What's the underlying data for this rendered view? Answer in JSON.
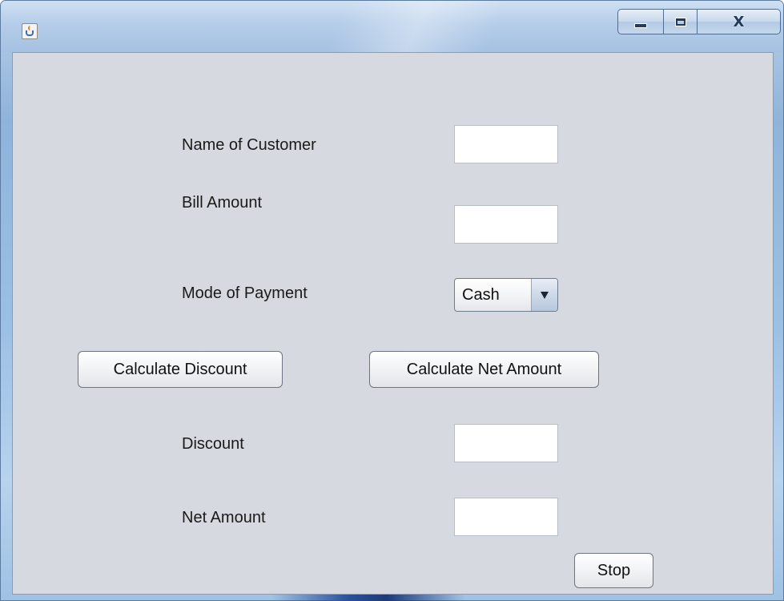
{
  "window": {
    "title": "",
    "icon": "java-cup-icon",
    "controls": {
      "minimize": "minimize-icon",
      "maximize": "maximize-icon",
      "close_label": "X"
    }
  },
  "form": {
    "customer_name": {
      "label": "Name of Customer",
      "value": ""
    },
    "bill_amount": {
      "label": "Bill Amount",
      "value": ""
    },
    "payment_mode": {
      "label": "Mode of Payment",
      "selected": "Cash"
    },
    "discount": {
      "label": "Discount",
      "value": ""
    },
    "net_amount": {
      "label": "Net Amount",
      "value": ""
    }
  },
  "buttons": {
    "calculate_discount": "Calculate Discount",
    "calculate_net_amount": "Calculate Net Amount",
    "stop": "Stop"
  },
  "colors": {
    "client_background": "#d6d9df",
    "close_button": "#c8412a",
    "title_bar": "#b5cde9"
  }
}
